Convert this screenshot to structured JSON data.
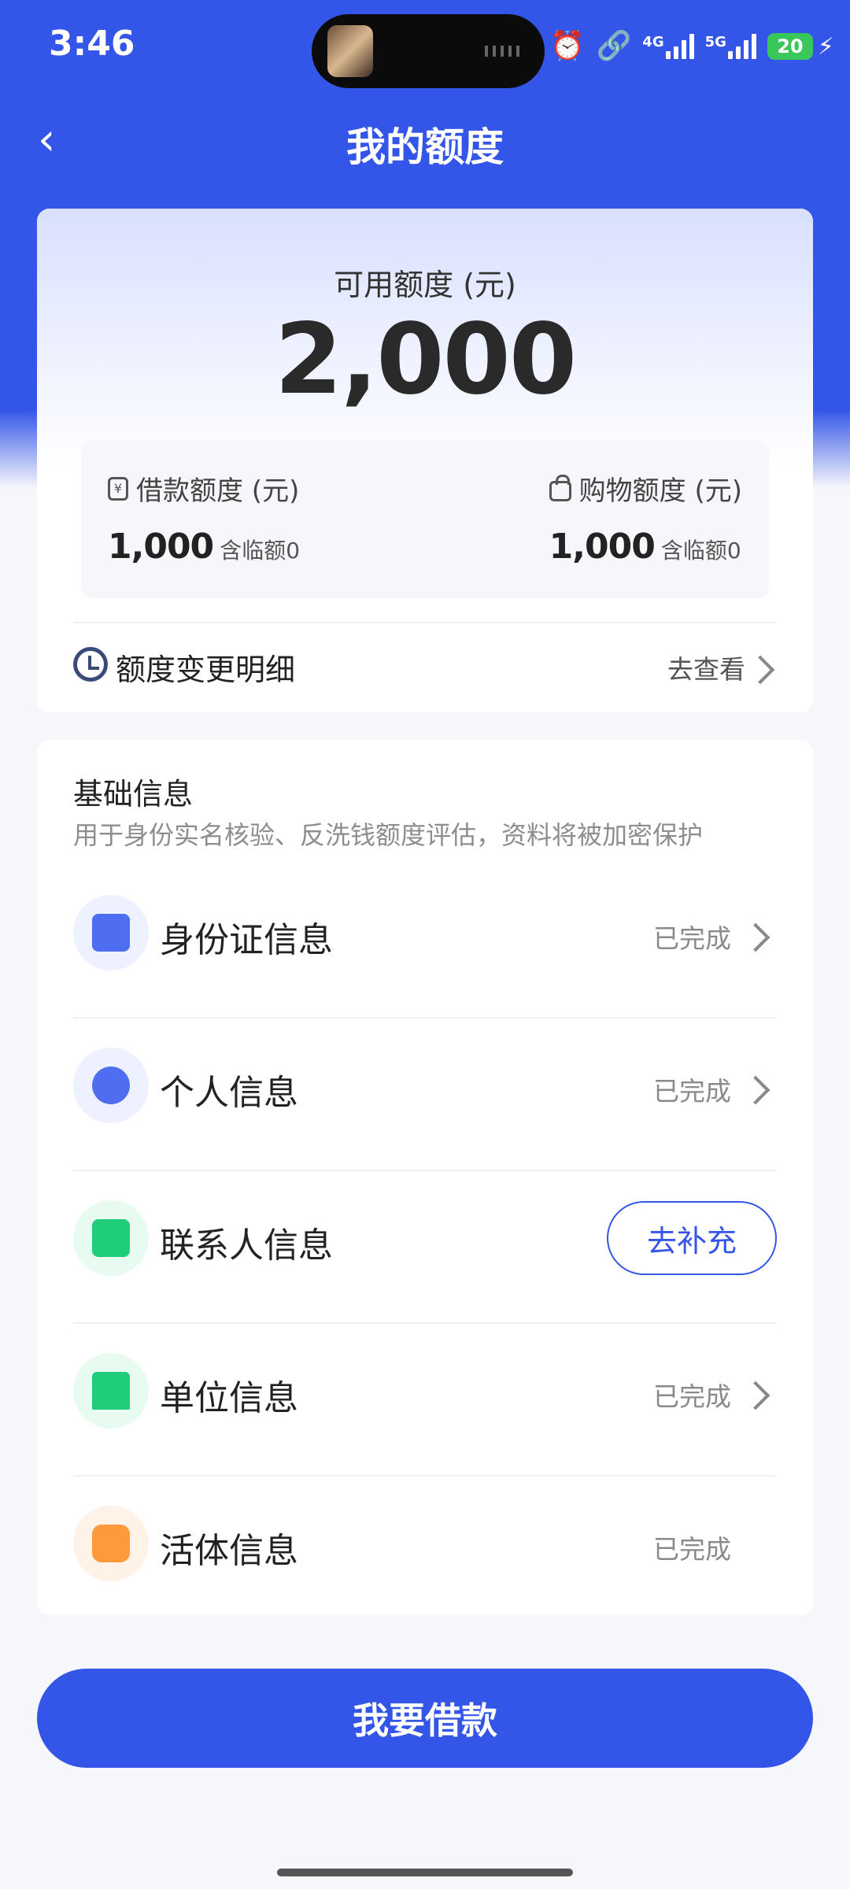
{
  "status_bar": {
    "time": "3:46",
    "net_4g": "4G",
    "net_5g": "5G",
    "battery": "20"
  },
  "header": {
    "title": "我的额度"
  },
  "quota": {
    "available_label": "可用额度 (元)",
    "available_value": "2,000",
    "loan": {
      "label": "借款额度 (元)",
      "value": "1,000",
      "note": "含临额0",
      "icon": "¥"
    },
    "shopping": {
      "label": "购物额度 (元)",
      "value": "1,000",
      "note": "含临额0"
    },
    "history": {
      "label": "额度变更明细",
      "action": "去查看"
    }
  },
  "basic_info": {
    "title": "基础信息",
    "subtitle": "用于身份实名核验、反洗钱额度评估，资料将被加密保护",
    "items": [
      {
        "label": "身份证信息",
        "status": "已完成",
        "icon": "id-card-icon",
        "color": "#4f6df0"
      },
      {
        "label": "个人信息",
        "status": "已完成",
        "icon": "person-icon",
        "color": "#4f6df0"
      },
      {
        "label": "联系人信息",
        "action": "去补充",
        "icon": "contacts-icon",
        "color": "#1fcd7a"
      },
      {
        "label": "单位信息",
        "status": "已完成",
        "icon": "building-icon",
        "color": "#1fcd7a"
      },
      {
        "label": "活体信息",
        "status": "已完成",
        "icon": "face-icon",
        "color": "#ff9a3c"
      }
    ]
  },
  "primary_button": {
    "label": "我要借款"
  },
  "colors": {
    "brand": "#3355e8",
    "background": "#f6f7fb"
  }
}
